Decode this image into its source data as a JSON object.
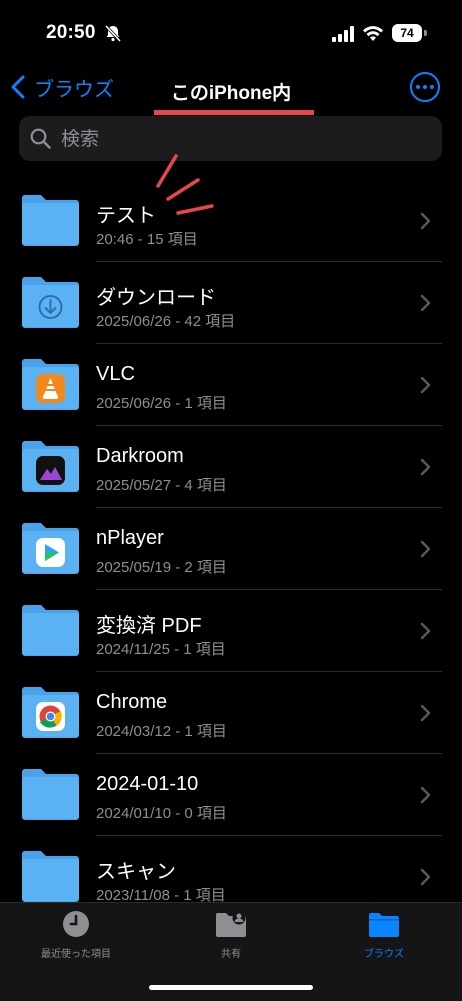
{
  "status": {
    "time": "20:50",
    "battery": "74"
  },
  "nav": {
    "back_label": "ブラウズ",
    "title": "このiPhone内"
  },
  "search": {
    "placeholder": "検索"
  },
  "items": [
    {
      "name": "テスト",
      "meta": "20:46 - 15 項目",
      "icon": "plain"
    },
    {
      "name": "ダウンロード",
      "meta": "2025/06/26 - 42 項目",
      "icon": "download"
    },
    {
      "name": "VLC",
      "meta": "2025/06/26 - 1 項目",
      "icon": "vlc"
    },
    {
      "name": "Darkroom",
      "meta": "2025/05/27 - 4 項目",
      "icon": "darkroom"
    },
    {
      "name": "nPlayer",
      "meta": "2025/05/19 - 2 項目",
      "icon": "nplayer"
    },
    {
      "name": "変換済 PDF",
      "meta": "2024/11/25 - 1 項目",
      "icon": "plain"
    },
    {
      "name": "Chrome",
      "meta": "2024/03/12 - 1 項目",
      "icon": "chrome"
    },
    {
      "name": "2024-01-10",
      "meta": "2024/01/10 - 0 項目",
      "icon": "plain"
    },
    {
      "name": "スキャン",
      "meta": "2023/11/08 - 1 項目",
      "icon": "plain"
    }
  ],
  "tabs": [
    {
      "label": "最近使った項目",
      "icon": "clock-icon",
      "active": false
    },
    {
      "label": "共有",
      "icon": "shared-folder-icon",
      "active": false
    },
    {
      "label": "ブラウズ",
      "icon": "folder-icon",
      "active": true
    }
  ],
  "colors": {
    "accent": "#0a84ff",
    "folder": "#56aff0",
    "annotation": "#e8464a"
  }
}
